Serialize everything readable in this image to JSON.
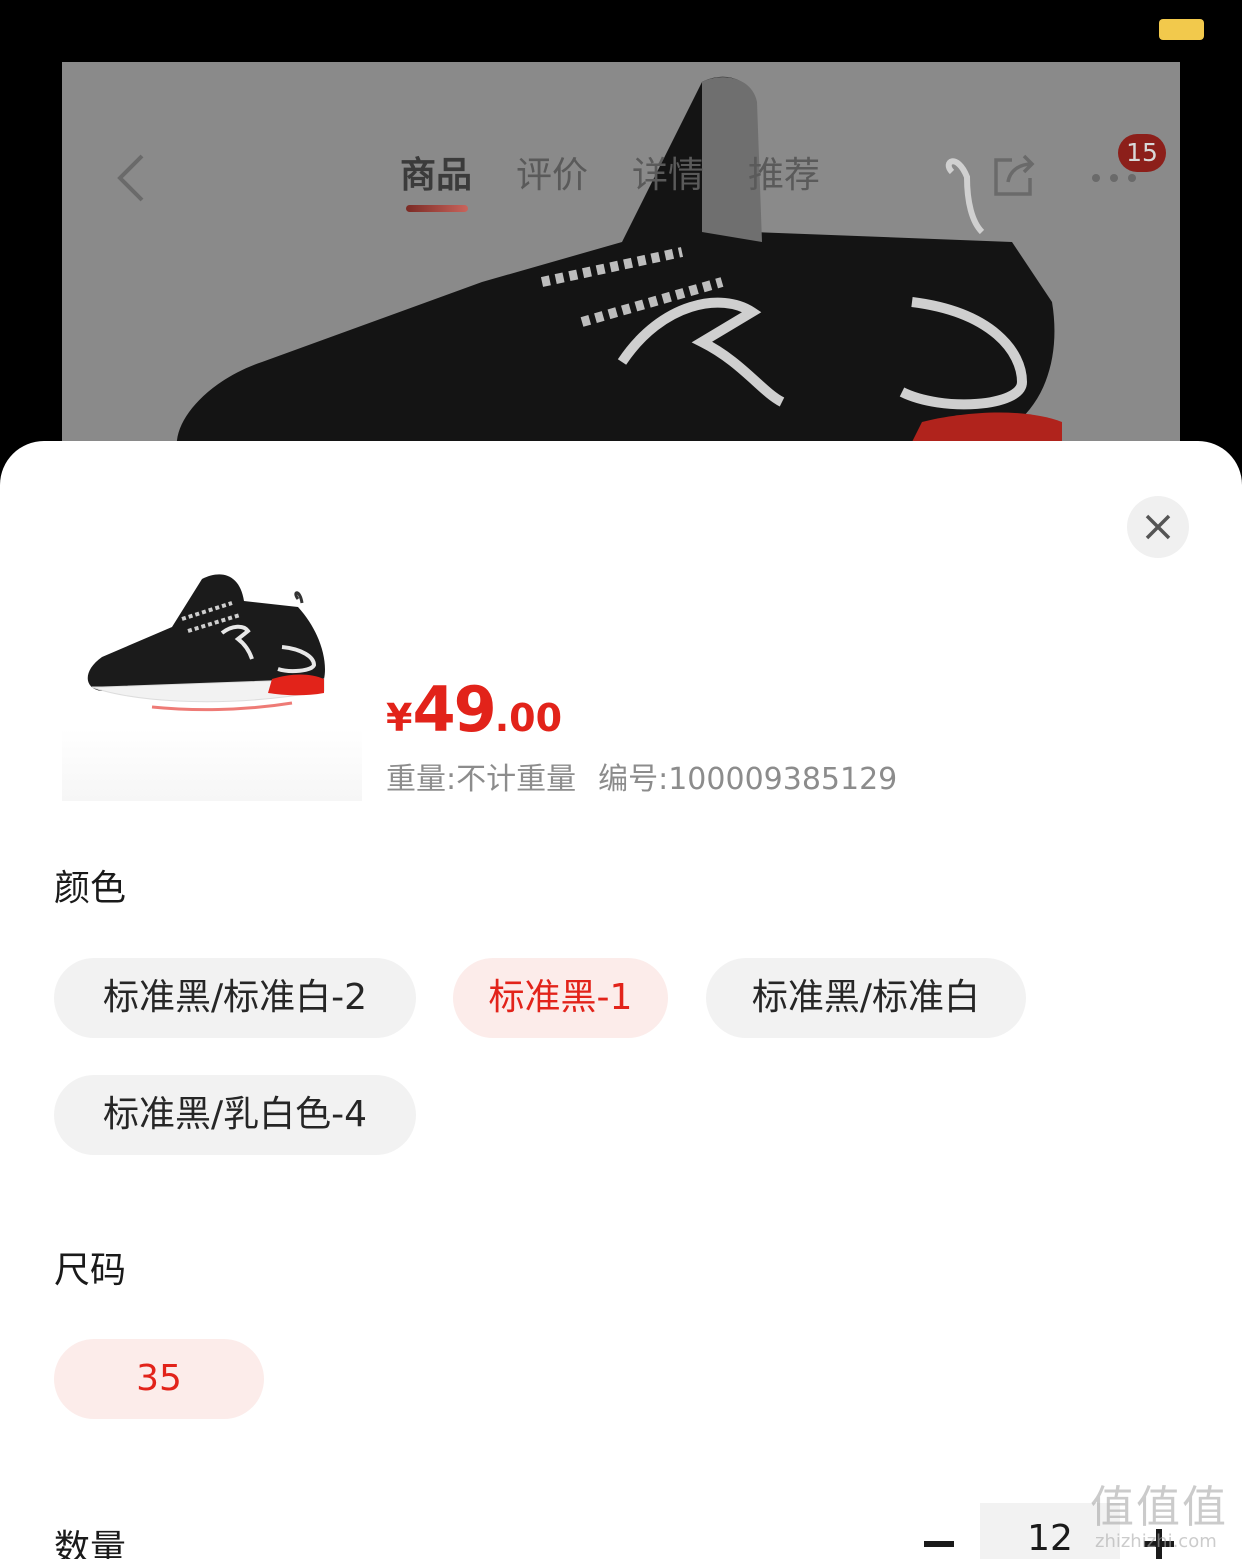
{
  "nav": {
    "tabs": [
      "商品",
      "评价",
      "详情",
      "推荐"
    ],
    "active_tab": 0,
    "cart_badge": "15",
    "back_icon": "chevron-left-icon",
    "share_icon": "share-icon",
    "more_icon": "more-dots-icon"
  },
  "product": {
    "price_symbol": "¥",
    "price_integer": "49",
    "price_decimal": ".00",
    "weight": "重量:不计重量",
    "sku": "编号:100009385129"
  },
  "color": {
    "title": "颜色",
    "options": [
      "标准黑/标准白-2",
      "标准黑-1",
      "标准黑/标准白",
      "标准黑/乳白色-4"
    ],
    "selected": "标准黑-1"
  },
  "size": {
    "title": "尺码",
    "options": [
      "35"
    ],
    "selected": "35"
  },
  "quantity": {
    "title": "数量",
    "value": "12"
  },
  "watermark": {
    "text": "值值值",
    "url": "zhizhizhi.com"
  },
  "colors": {
    "accent": "#e2231a",
    "chip_selected_bg": "#fcecea",
    "chip_bg": "#f2f2f2",
    "battery": "#f2c94c"
  }
}
